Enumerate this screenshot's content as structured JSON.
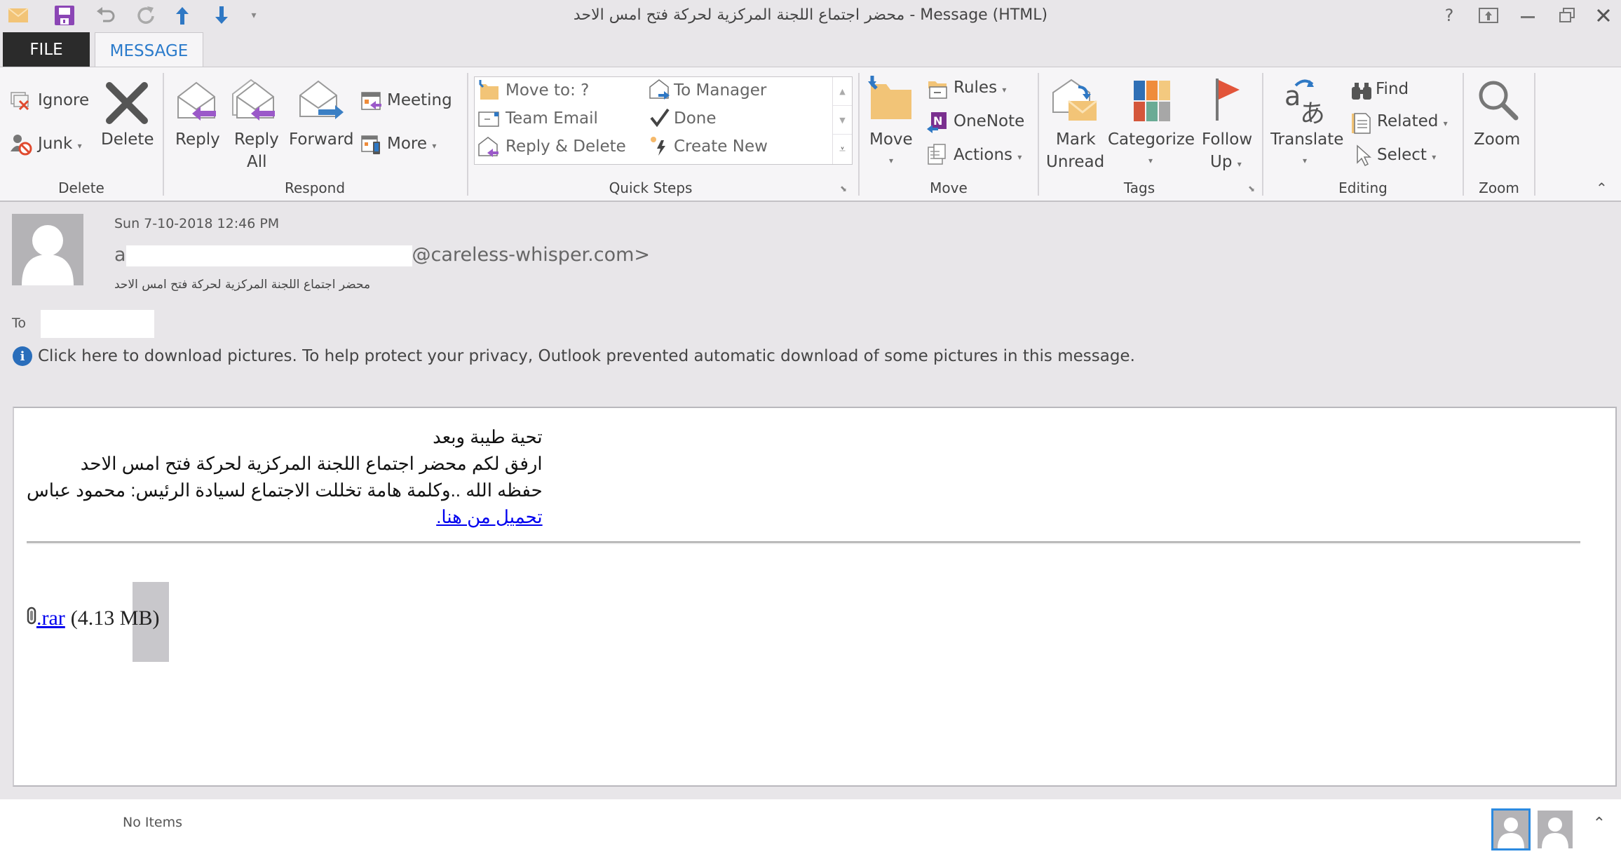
{
  "window": {
    "title": "محضر اجتماع اللجنة المركزية لحركة فتح امس الاحد - Message (HTML)",
    "quick_access": [
      "mail-icon",
      "save-icon",
      "undo-icon",
      "redo-icon",
      "previous-item-icon",
      "next-item-icon",
      "customize-qat-icon"
    ],
    "controls": {
      "help": "?",
      "ribbon_options": "ribbon-display-options-icon",
      "minimize": "minimize-icon",
      "restore": "restore-icon",
      "close": "close-icon"
    }
  },
  "tabs": {
    "file": "FILE",
    "message": "MESSAGE"
  },
  "ribbon": {
    "delete_group": {
      "label": "Delete",
      "ignore": "Ignore",
      "junk": "Junk",
      "delete": "Delete"
    },
    "respond_group": {
      "label": "Respond",
      "reply": "Reply",
      "reply_all_1": "Reply",
      "reply_all_2": "All",
      "forward": "Forward",
      "meeting": "Meeting",
      "more": "More"
    },
    "quick_steps": {
      "label": "Quick Steps",
      "items": [
        "Move to: ?",
        "Team Email",
        "Reply & Delete",
        "To Manager",
        "Done",
        "Create New"
      ]
    },
    "move_group": {
      "label": "Move",
      "move": "Move",
      "rules": "Rules",
      "onenote": "OneNote",
      "actions": "Actions"
    },
    "tags_group": {
      "label": "Tags",
      "mark_unread_1": "Mark",
      "mark_unread_2": "Unread",
      "categorize": "Categorize",
      "follow_up_1": "Follow",
      "follow_up_2": "Up",
      "category_colors": [
        "#2f6fb5",
        "#ef8c3b",
        "#f3c97f",
        "#d4573b",
        "#6aab95",
        "#a7a7a7"
      ],
      "flag_color": "#e2553b"
    },
    "editing_group": {
      "label": "Editing",
      "translate": "Translate",
      "find": "Find",
      "related": "Related",
      "select": "Select"
    },
    "zoom_group": {
      "label": "Zoom",
      "zoom": "Zoom"
    }
  },
  "message": {
    "date": "Sun 7-10-2018 12:46 PM",
    "sender_prefix": "a",
    "sender_suffix": "@careless-whisper.com>",
    "subject": "محضر اجتماع اللجنة المركزية لحركة فتح امس الاحد",
    "to_label": "To",
    "info_bar": "Click here to download pictures. To help protect your privacy, Outlook prevented automatic download of some pictures in this message.",
    "body_lines": [
      "تحية طيبة وبعد",
      "ارفق لكم محضر اجتماع اللجنة المركزية لحركة فتح امس الاحد",
      "حفظه الله ..وكلمة هامة تخللت الاجتماع لسيادة الرئيس: محمود عباس"
    ],
    "body_link": "تحميل من هنا.",
    "attachment": {
      "name": ".rar",
      "size": "(4.13 MB)"
    }
  },
  "status": {
    "text": "No Items"
  },
  "colors": {
    "accent": "#2b7bcb",
    "file_tab_bg": "#2b2b2b",
    "link": "#0000ee"
  }
}
